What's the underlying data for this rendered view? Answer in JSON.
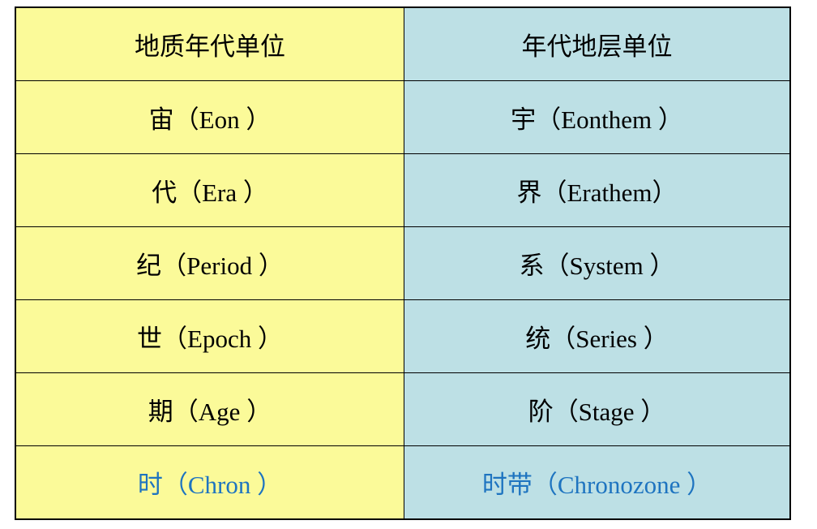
{
  "table": {
    "headers": [
      "地质年代单位",
      "年代地层单位"
    ],
    "rows": [
      {
        "left_cn": "宙",
        "left_en": "（Eon ）",
        "right_cn": "宇",
        "right_en": "（Eonthem ）"
      },
      {
        "left_cn": "代",
        "left_en": "（Era ）",
        "right_cn": "界",
        "right_en": "（Erathem）"
      },
      {
        "left_cn": "纪",
        "left_en": "（Period ）",
        "right_cn": "系",
        "right_en": "（System ）"
      },
      {
        "left_cn": "世",
        "left_en": "（Epoch ）",
        "right_cn": "统",
        "right_en": "（Series ）"
      },
      {
        "left_cn": "期",
        "left_en": "（Age ）",
        "right_cn": "阶",
        "right_en": "（Stage ）"
      },
      {
        "left_cn": "时",
        "left_en": "（Chron ）",
        "right_cn": "时带",
        "right_en": "（Chronozone ）"
      }
    ]
  },
  "colors": {
    "left_column_bg": "#fbfa99",
    "right_column_bg": "#bde0e5",
    "border": "#000000",
    "highlight_text": "#1e74c0"
  }
}
